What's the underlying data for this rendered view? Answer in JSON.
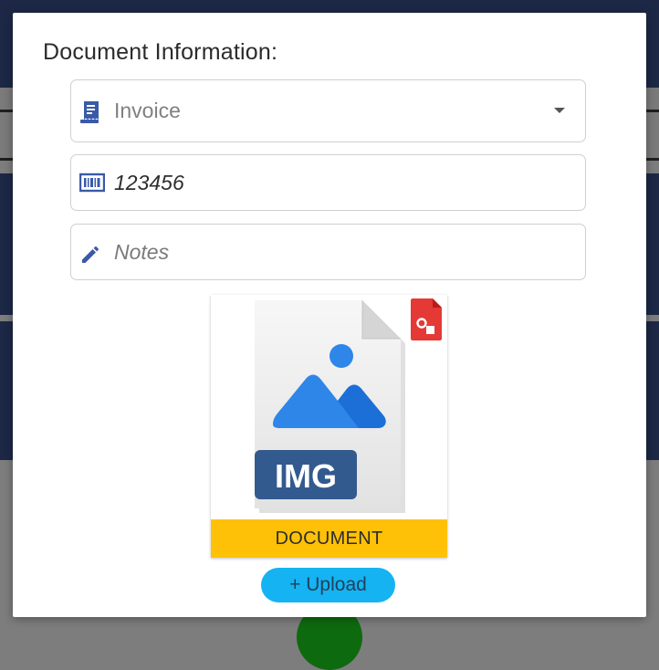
{
  "dialog": {
    "title": "Document Information:",
    "document_type": {
      "value": "Invoice",
      "icon": "receipt-icon"
    },
    "document_number": {
      "value": "123456",
      "icon": "barcode-icon"
    },
    "notes": {
      "placeholder": "Notes",
      "icon": "pencil-icon"
    },
    "attachment": {
      "file_type_label": "IMG",
      "badge_label": "DOCUMENT",
      "icon": "image-file-icon",
      "corner_icon": "file-shapes-icon"
    },
    "upload_label": "+ Upload"
  },
  "colors": {
    "accent": "#15b3f2",
    "badge": "#ffc107",
    "icon_blue": "#3a5aa8",
    "backdrop": "#1c2846"
  }
}
